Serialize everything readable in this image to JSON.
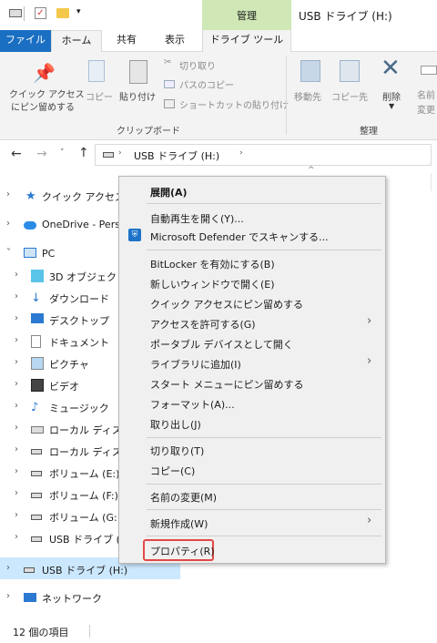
{
  "title_bar": {
    "manage_label": "管理",
    "window_title": "USB ドライブ (H:)"
  },
  "tabs": {
    "file": "ファイル",
    "home": "ホーム",
    "share": "共有",
    "view": "表示",
    "drive_tools": "ドライブ ツール"
  },
  "ribbon": {
    "pin_quick_access": [
      "クイック アクセス",
      "にピン留めする"
    ],
    "copy": "コピー",
    "paste": "貼り付け",
    "cut": "切り取り",
    "copy_path": "パスのコピー",
    "paste_shortcut": "ショートカットの貼り付け",
    "clipboard_group": "クリップボード",
    "move_to": "移動先",
    "copy_to": "コピー先",
    "delete": "削除",
    "rename_partial": [
      "名前",
      "変更"
    ],
    "organize_group": "整理"
  },
  "address": {
    "path": "USB ドライブ (H:)"
  },
  "nav": {
    "items": [
      {
        "label": "クイック アクセス",
        "icon": "star-icon"
      },
      {
        "label": "OneDrive - Perso",
        "icon": "cloud-icon"
      },
      {
        "label": "PC",
        "icon": "pc-icon"
      },
      {
        "label": "3D オブジェクト",
        "icon": "cube-icon"
      },
      {
        "label": "ダウンロード",
        "icon": "download-icon"
      },
      {
        "label": "デスクトップ",
        "icon": "desktop-icon"
      },
      {
        "label": "ドキュメント",
        "icon": "document-icon"
      },
      {
        "label": "ピクチャ",
        "icon": "picture-icon"
      },
      {
        "label": "ビデオ",
        "icon": "video-icon"
      },
      {
        "label": "ミュージック",
        "icon": "music-icon"
      },
      {
        "label": "ローカル ディスク",
        "icon": "local-disk-icon"
      },
      {
        "label": "ローカル ディスク",
        "icon": "drive-icon"
      },
      {
        "label": "ボリューム (E:)",
        "icon": "drive-icon"
      },
      {
        "label": "ボリューム (F:)",
        "icon": "drive-icon"
      },
      {
        "label": "ボリューム (G:)",
        "icon": "drive-icon"
      },
      {
        "label": "USB ドライブ (H:",
        "icon": "drive-icon"
      },
      {
        "label": "USB ドライブ (H:)",
        "icon": "drive-icon"
      },
      {
        "label": "ネットワーク",
        "icon": "network-icon"
      }
    ]
  },
  "context_menu": {
    "expand": "展開(A)",
    "autoplay": "自動再生を開く(Y)...",
    "defender": "Microsoft Defender でスキャンする...",
    "bitlocker": "BitLocker を有効にする(B)",
    "new_window": "新しいウィンドウで開く(E)",
    "pin_quick": "クイック アクセスにピン留めする",
    "give_access": "アクセスを許可する(G)",
    "open_portable": "ポータブル デバイスとして開く",
    "add_library": "ライブラリに追加(I)",
    "pin_start": "スタート メニューにピン留めする",
    "format": "フォーマット(A)...",
    "eject": "取り出し(J)",
    "cut": "切り取り(T)",
    "copy": "コピー(C)",
    "rename": "名前の変更(M)",
    "new": "新規作成(W)",
    "properties": "プロパティ(R)"
  },
  "status_bar": {
    "item_count": "12 個の項目"
  },
  "colors": {
    "file_tab": "#1a6fc2",
    "manage_tab": "#cfe8b6",
    "selected_nav": "#cce8ff",
    "highlight_box": "#e34848"
  }
}
